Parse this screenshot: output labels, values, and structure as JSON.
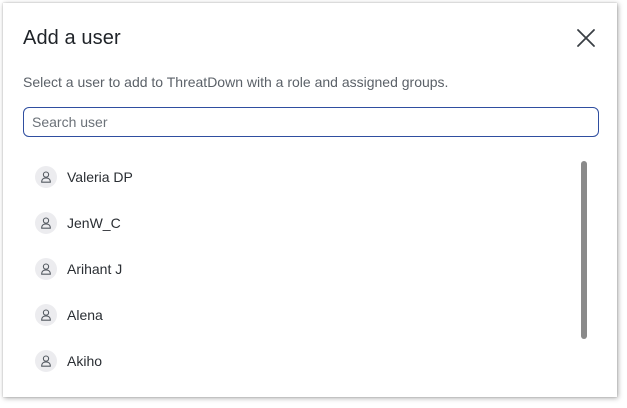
{
  "dialog": {
    "title": "Add a user",
    "subtitle": "Select a user to add to ThreatDown with a role and assigned groups.",
    "close_icon": "close-icon"
  },
  "search": {
    "placeholder": "Search user",
    "value": ""
  },
  "users": [
    {
      "name": "Valeria DP",
      "icon": "user-icon"
    },
    {
      "name": "JenW_C",
      "icon": "user-icon"
    },
    {
      "name": "Arihant J",
      "icon": "user-icon"
    },
    {
      "name": "Alena",
      "icon": "user-icon"
    },
    {
      "name": "Akiho",
      "icon": "user-icon"
    }
  ],
  "colors": {
    "search_border": "#2f4ea0",
    "avatar_bg": "#ececef",
    "scrollbar": "#8a8a8a"
  }
}
